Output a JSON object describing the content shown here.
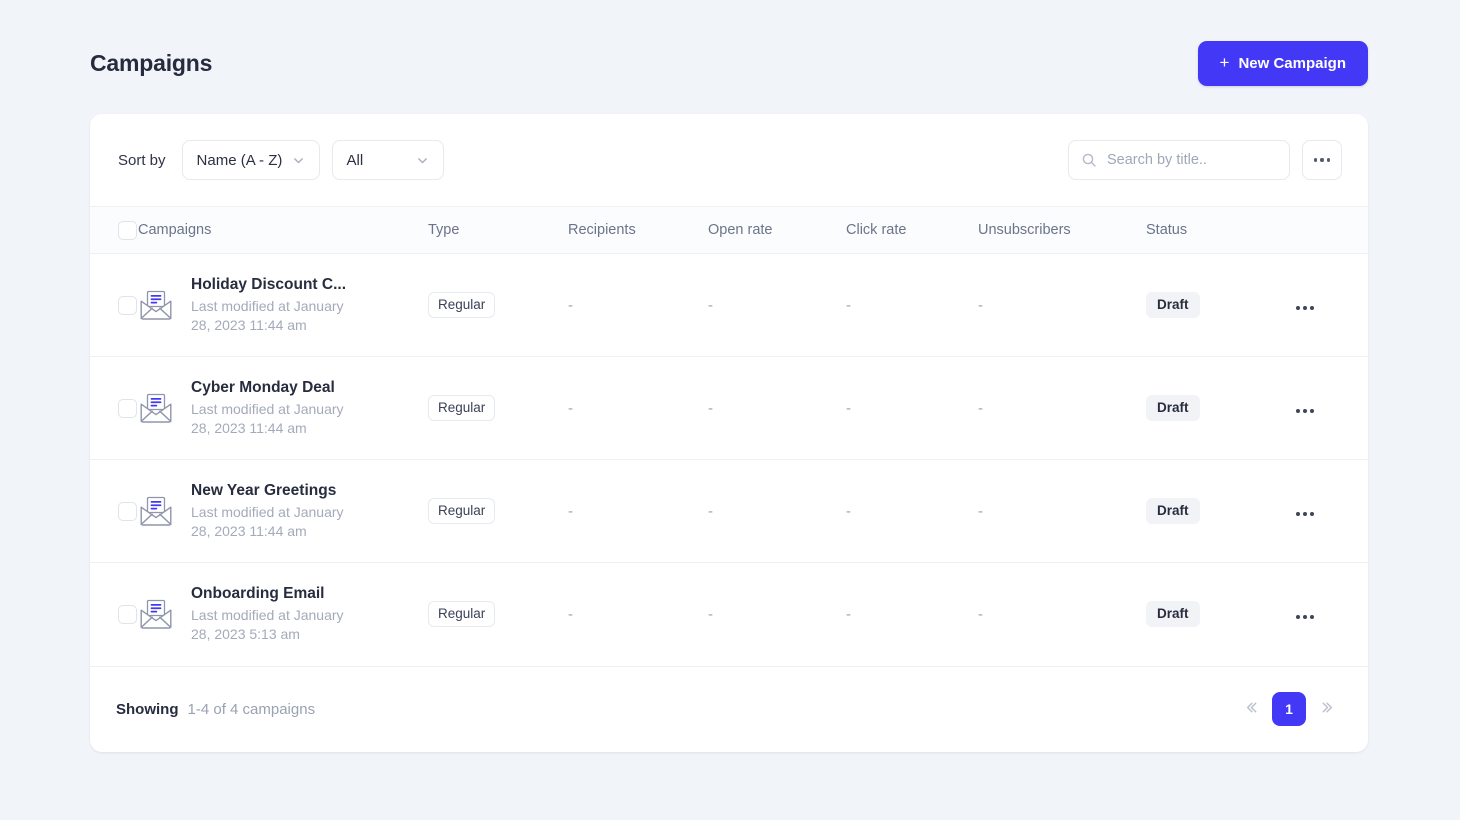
{
  "header": {
    "title": "Campaigns",
    "new_campaign_label": "New Campaign",
    "plus_glyph": "+"
  },
  "toolbar": {
    "sort_label": "Sort by",
    "sort_value": "Name (A - Z)",
    "filter_value": "All",
    "search_placeholder": "Search by title..",
    "search_value": ""
  },
  "table": {
    "columns": {
      "campaigns": "Campaigns",
      "type": "Type",
      "recipients": "Recipients",
      "open_rate": "Open rate",
      "click_rate": "Click rate",
      "unsubscribers": "Unsubscribers",
      "status": "Status"
    },
    "rows": [
      {
        "name": "Holiday Discount C...",
        "meta": "Last modified at January 28, 2023 11:44 am",
        "type": "Regular",
        "recipients": "-",
        "open_rate": "-",
        "click_rate": "-",
        "unsubscribers": "-",
        "status": "Draft"
      },
      {
        "name": "Cyber Monday Deal",
        "meta": "Last modified at January 28, 2023 11:44 am",
        "type": "Regular",
        "recipients": "-",
        "open_rate": "-",
        "click_rate": "-",
        "unsubscribers": "-",
        "status": "Draft"
      },
      {
        "name": "New Year Greetings",
        "meta": "Last modified at January 28, 2023 11:44 am",
        "type": "Regular",
        "recipients": "-",
        "open_rate": "-",
        "click_rate": "-",
        "unsubscribers": "-",
        "status": "Draft"
      },
      {
        "name": "Onboarding Email",
        "meta": "Last modified at January 28, 2023 5:13 am",
        "type": "Regular",
        "recipients": "-",
        "open_rate": "-",
        "click_rate": "-",
        "unsubscribers": "-",
        "status": "Draft"
      }
    ]
  },
  "footer": {
    "showing_label": "Showing",
    "showing_value": "1-4 of 4 campaigns",
    "current_page": "1"
  },
  "colors": {
    "accent": "#4338f5",
    "page_bg": "#f1f5f9",
    "card_bg": "#ffffff",
    "text_dark": "#272c3e",
    "text_muted": "#9aa1b2",
    "border": "#eef0f4",
    "badge_bg": "#f2f3f6"
  }
}
